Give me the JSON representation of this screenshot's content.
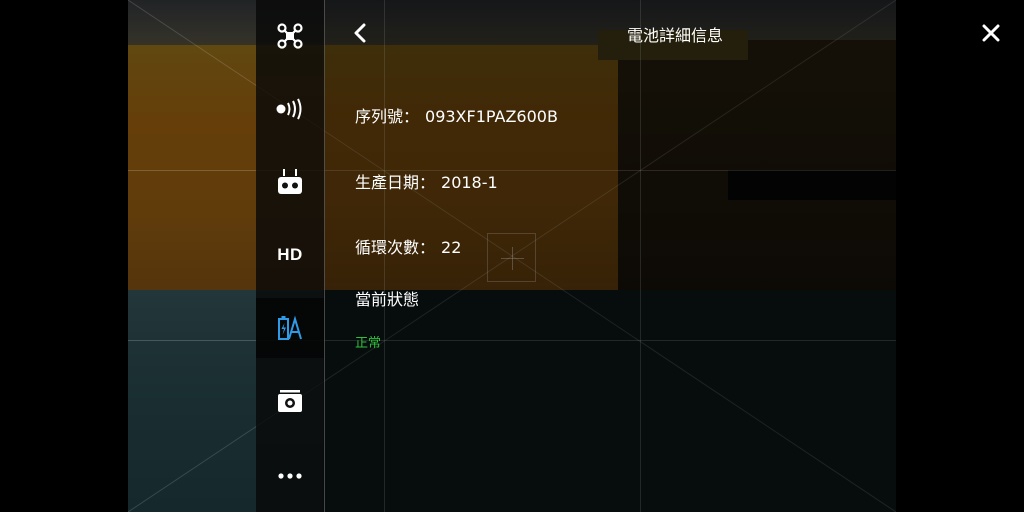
{
  "header": {
    "title": "電池詳細信息",
    "back_icon": "chevron-left-icon",
    "close_icon": "close-icon"
  },
  "side_menu": {
    "items": [
      {
        "icon": "aircraft-icon"
      },
      {
        "icon": "signal-icon"
      },
      {
        "icon": "remote-controller-icon"
      },
      {
        "icon": "hd-icon",
        "label": "HD"
      },
      {
        "icon": "battery-icon",
        "active": true
      },
      {
        "icon": "camera-icon"
      },
      {
        "icon": "more-icon"
      }
    ]
  },
  "battery": {
    "serial_label": "序列號：",
    "serial_value": "093XF1PAZ600B",
    "production_date_label": "生產日期：",
    "production_date_value": "2018-1",
    "cycle_count_label": "循環次數：",
    "cycle_count_value": "22",
    "status_label": "當前狀態",
    "status_value": "正常"
  },
  "colors": {
    "accent": "#2f9be8",
    "status_ok": "#2fbf3d"
  }
}
